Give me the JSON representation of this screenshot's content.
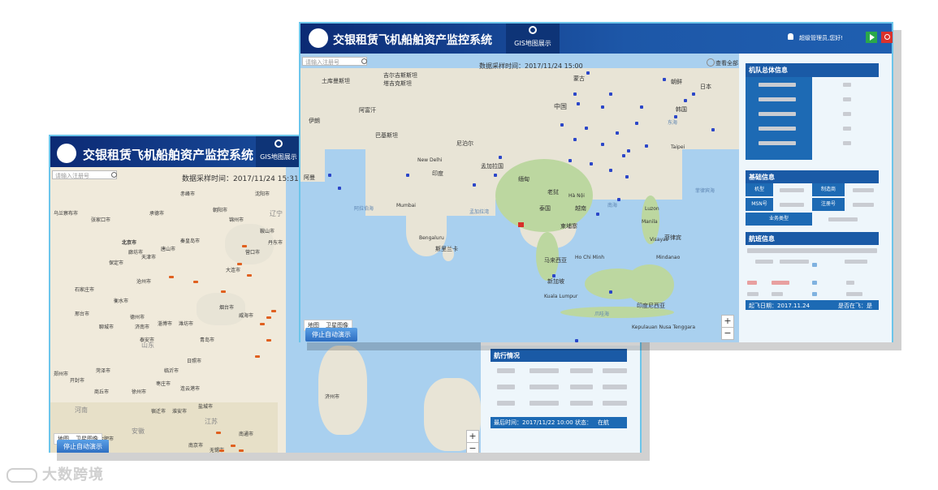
{
  "app_title": "交银租赁飞机船舶资产监控系统",
  "back_window": {
    "tab_label": "GIS地图展示",
    "search_placeholder": "请输入注册号",
    "timestamp": "数据采样时间：2017/11/24  15:31",
    "map_type": [
      "地图",
      "卫星图像"
    ],
    "stop_button": "停止自动演示",
    "zoom_in": "+",
    "zoom_out": "−",
    "panel_title": "航行情况",
    "footer_time": "最后时间：2017/11/22 10:00",
    "footer_state_label": "状态：",
    "footer_state_value": "在航",
    "cities": [
      "乌兰察布市",
      "张家口市",
      "承德市",
      "北京市",
      "天津市",
      "廊坊市",
      "保定市",
      "沧州市",
      "石家庄市",
      "衡水市",
      "德州市",
      "济南市",
      "潍坊市",
      "青岛市",
      "烟台市",
      "威海市",
      "临沂市",
      "日照市",
      "连云港市",
      "徐州市",
      "商丘市",
      "菏泽市",
      "郑州市",
      "开封市",
      "大连市",
      "丹东市",
      "沈阳市",
      "济州市",
      "南京市",
      "合肥市",
      "无锡市",
      "南通市",
      "江苏",
      "山东",
      "河南",
      "赤峰市",
      "朝阳市",
      "锦州市",
      "营口市",
      "鞍山市",
      "辽宁",
      "秦皇岛市",
      "唐山市",
      "邢台市",
      "聊城市",
      "泰安市",
      "淄博市",
      "枣庄市",
      "宿迁市",
      "淮安市",
      "盐城市",
      "安徽"
    ]
  },
  "front_window": {
    "tab_label": "GIS地图展示",
    "user_text": "超级管理员,您好!",
    "search_placeholder": "请输入注册号",
    "timestamp": "数据采样时间：2017/11/24  15:00",
    "overview_label": "查看全部",
    "map_type": [
      "地图",
      "卫星图像"
    ],
    "stop_button": "停止自动演示",
    "zoom_in": "+",
    "zoom_out": "−",
    "countries": [
      "土库曼斯坦",
      "塔吉克斯坦",
      "吉尔吉斯斯坦",
      "阿富汗",
      "伊朗",
      "巴基斯坦",
      "印度",
      "尼泊尔",
      "孟加拉国",
      "缅甸",
      "泰国",
      "老挝",
      "越南",
      "柬埔寨",
      "中国",
      "蒙古",
      "朝鲜",
      "韩国",
      "日本",
      "菲律宾",
      "马来西亚",
      "新加坡",
      "印度尼西亚",
      "斯里兰卡",
      "阿曼",
      "阿拉伯海",
      "孟加拉湾",
      "南海",
      "东海",
      "菲律宾海",
      "爪哇海"
    ],
    "cities": [
      "New Delhi",
      "Mumbai",
      "Bengaluru",
      "Hà Nội",
      "Ho Chi Minh",
      "Kuala Lumpur",
      "Manila",
      "Kepulauan Nusa Tenggara",
      "Luzon",
      "Mindanao",
      "Visayas",
      "Taipei"
    ],
    "fleet_panel": {
      "title": "机队总体信息"
    },
    "basic_panel": {
      "title": "基础信息",
      "labels": [
        "机型",
        "制造商",
        "MSN号",
        "注册号",
        "业务类型"
      ]
    },
    "flight_panel": {
      "title": "航班信息",
      "footer_date": "起飞日期：2017.11.24",
      "footer_status": "是否在飞：是"
    }
  },
  "watermark": "大数跨境",
  "colors": {
    "header": "#1d57a8",
    "accent": "#1d6ab4",
    "border": "#6cc5ea",
    "sea": "#a9d0ef",
    "plane": "#2b46c8",
    "ship": "#e0601f"
  }
}
